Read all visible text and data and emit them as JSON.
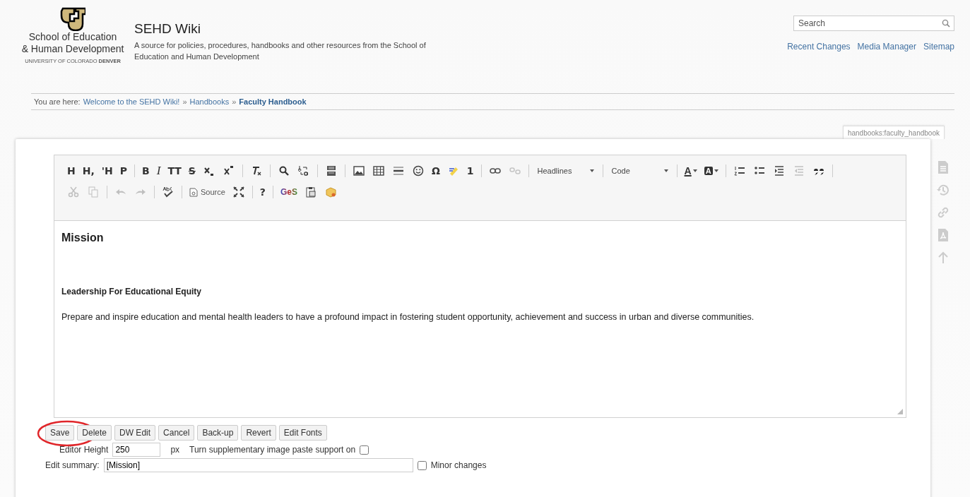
{
  "header": {
    "logo_line_1": "School of Education",
    "logo_line_2": "& Human Development",
    "logo_subline_1": "UNIVERSITY OF COLORADO ",
    "logo_subline_2": "DENVER",
    "title": "SEHD Wiki",
    "tagline": "A source for policies, procedures, handbooks and other resources from the School of Education and Human Development"
  },
  "search": {
    "placeholder": "Search"
  },
  "nav_links": [
    "Recent Changes",
    "Media Manager",
    "Sitemap"
  ],
  "breadcrumbs": {
    "label": "You are here:",
    "separator": "»",
    "items": [
      {
        "text": "Welcome to the SEHD Wiki!",
        "current": false
      },
      {
        "text": "Handbooks",
        "current": false
      },
      {
        "text": "Faculty Handbook",
        "current": true
      }
    ]
  },
  "page_id": "handbooks:faculty_handbook",
  "toolbar_rows": [
    [
      {
        "kind": "glyph",
        "label": "H",
        "disabled": false
      },
      {
        "kind": "glyph",
        "label": "H,",
        "disabled": false
      },
      {
        "kind": "glyph",
        "label": "'H",
        "disabled": false
      },
      {
        "kind": "glyph",
        "label": "P",
        "disabled": false
      },
      {
        "kind": "sep"
      },
      {
        "kind": "glyph",
        "label": "B",
        "disabled": false
      },
      {
        "kind": "italic",
        "label": "I",
        "disabled": false
      },
      {
        "kind": "glyph",
        "label": "TT",
        "disabled": false
      },
      {
        "kind": "strike",
        "label": "S",
        "disabled": false
      },
      {
        "kind": "subscript",
        "disabled": false
      },
      {
        "kind": "superscript",
        "disabled": false
      },
      {
        "kind": "sep"
      },
      {
        "kind": "clearformat",
        "disabled": false
      },
      {
        "kind": "sep"
      },
      {
        "kind": "search",
        "disabled": false
      },
      {
        "kind": "replace",
        "disabled": false
      },
      {
        "kind": "sep"
      },
      {
        "kind": "pagebreak",
        "disabled": false
      },
      {
        "kind": "sep"
      },
      {
        "kind": "image",
        "disabled": false
      },
      {
        "kind": "table",
        "disabled": false
      },
      {
        "kind": "rule",
        "disabled": false
      },
      {
        "kind": "smiley",
        "disabled": false
      },
      {
        "kind": "glyph",
        "label": "Ω",
        "disabled": false
      },
      {
        "kind": "marker",
        "disabled": false
      },
      {
        "kind": "glyph",
        "label": "1",
        "disabled": false
      },
      {
        "kind": "sep"
      },
      {
        "kind": "link",
        "disabled": false
      },
      {
        "kind": "unlink",
        "disabled": true
      },
      {
        "kind": "sep"
      },
      {
        "kind": "combo",
        "label": "Headlines"
      },
      {
        "kind": "sep"
      },
      {
        "kind": "combo",
        "label": "Code"
      },
      {
        "kind": "sep"
      },
      {
        "kind": "textcolor",
        "label": "A",
        "disabled": false
      },
      {
        "kind": "bgcolor",
        "label": "A",
        "disabled": false
      },
      {
        "kind": "sep"
      },
      {
        "kind": "numlist",
        "disabled": false
      },
      {
        "kind": "bulletlist",
        "disabled": false
      },
      {
        "kind": "indent",
        "disabled": false
      },
      {
        "kind": "outdent",
        "disabled": true
      },
      {
        "kind": "quote",
        "disabled": false
      },
      {
        "kind": "sep"
      }
    ],
    [
      {
        "kind": "cut",
        "disabled": true
      },
      {
        "kind": "copy",
        "disabled": true
      },
      {
        "kind": "sep"
      },
      {
        "kind": "undo",
        "disabled": true
      },
      {
        "kind": "redo",
        "disabled": true
      },
      {
        "kind": "sep"
      },
      {
        "kind": "spell",
        "disabled": false
      },
      {
        "kind": "sep"
      },
      {
        "kind": "source",
        "label": "Source",
        "disabled": false
      },
      {
        "kind": "maximize",
        "disabled": false
      },
      {
        "kind": "sep"
      },
      {
        "kind": "glyph",
        "label": "?",
        "disabled": false
      },
      {
        "kind": "sep"
      },
      {
        "kind": "ges",
        "label": "GeS",
        "disabled": false
      },
      {
        "kind": "paste",
        "disabled": false
      },
      {
        "kind": "package",
        "disabled": false
      }
    ]
  ],
  "content": [
    {
      "kind": "heading",
      "text": "Mission"
    },
    {
      "kind": "subheading",
      "text": "Leadership For Educational Equity"
    },
    {
      "kind": "paragraph",
      "text": "Prepare and inspire education and mental health leaders to have a profound impact in fostering student opportunity, achievement and success in urban and diverse communities."
    }
  ],
  "buttons": [
    {
      "label": "Save",
      "circled": true
    },
    {
      "label": "Delete",
      "circled": false
    },
    {
      "label": "DW Edit",
      "circled": false
    },
    {
      "label": "Cancel",
      "circled": false
    },
    {
      "label": "Back-up",
      "circled": false
    },
    {
      "label": "Revert",
      "circled": false
    },
    {
      "label": "Edit Fonts",
      "circled": false
    }
  ],
  "editor_height": {
    "label": "Editor Height",
    "value": "250",
    "unit": "px"
  },
  "paste_support": {
    "label": "Turn supplementary image paste support on",
    "checked": false
  },
  "summary": {
    "label": "Edit summary:",
    "value": "[Mission]"
  },
  "minor_changes": {
    "label": "Minor changes",
    "checked": false
  },
  "page_tools": [
    {
      "kind": "page"
    },
    {
      "kind": "history"
    },
    {
      "kind": "link"
    },
    {
      "kind": "pdf"
    },
    {
      "kind": "top"
    }
  ]
}
